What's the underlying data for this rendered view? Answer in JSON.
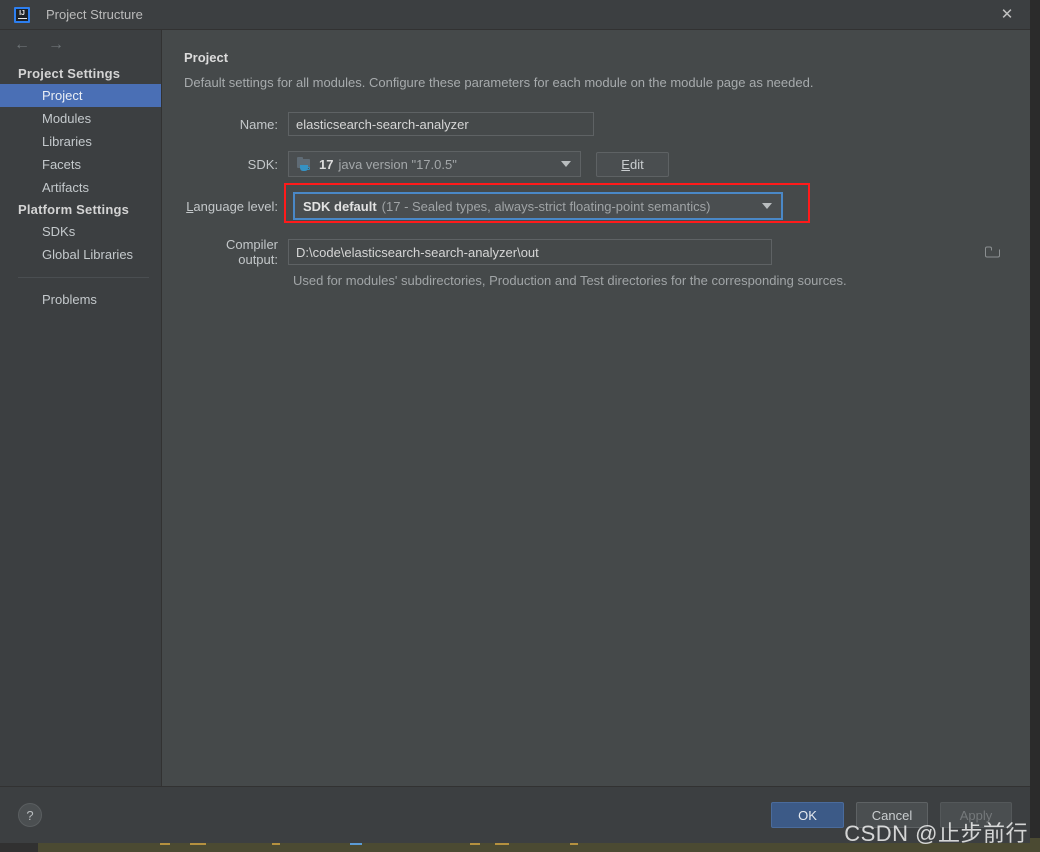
{
  "window": {
    "title": "Project Structure",
    "app_icon": "intellij-idea-icon",
    "close_label": "✕"
  },
  "navigation": {
    "back_arrow": "←",
    "forward_arrow": "→",
    "groups": [
      {
        "header": "Project Settings",
        "items": [
          {
            "label": "Project",
            "selected": true
          },
          {
            "label": "Modules",
            "selected": false
          },
          {
            "label": "Libraries",
            "selected": false
          },
          {
            "label": "Facets",
            "selected": false
          },
          {
            "label": "Artifacts",
            "selected": false
          }
        ]
      },
      {
        "header": "Platform Settings",
        "items": [
          {
            "label": "SDKs",
            "selected": false
          },
          {
            "label": "Global Libraries",
            "selected": false
          }
        ]
      }
    ],
    "extra_items": [
      {
        "label": "Problems",
        "selected": false
      }
    ]
  },
  "content": {
    "title": "Project",
    "subtitle": "Default settings for all modules. Configure these parameters for each module on the module page as needed.",
    "name": {
      "label": "Name:",
      "value": "elasticsearch-search-analyzer",
      "placeholder": ""
    },
    "sdk": {
      "label": "SDK:",
      "version": "17",
      "description": "java version \"17.0.5\"",
      "icon": "java-sdk-icon",
      "edit_button": "Edit",
      "edit_mnemonic": "E",
      "edit_rest": "dit"
    },
    "language_level": {
      "label_mnemonic": "L",
      "label_rest": "anguage level:",
      "primary": "SDK default",
      "secondary": "(17 - Sealed types, always-strict floating-point semantics)",
      "highlighted": true,
      "highlight_color": "#ff1a1a",
      "focus_color": "#4a88c7"
    },
    "compiler_output": {
      "label": "Compiler output:",
      "value": "D:\\code\\elasticsearch-search-analyzer\\out",
      "browse_icon": "folder-icon",
      "hint": "Used for modules' subdirectories, Production and Test directories for the corresponding sources."
    }
  },
  "footer": {
    "help_label": "?",
    "ok_label": "OK",
    "cancel_label": "Cancel",
    "apply_label": "Apply"
  },
  "watermark": {
    "text": "CSDN @止步前行"
  },
  "colors": {
    "dialog_background": "#3c3f41",
    "content_background": "#45494a",
    "selection_blue": "#4a6fb5",
    "ok_button_blue": "#3c5a87",
    "annotation_red": "#ff1a1a",
    "focus_blue": "#4a88c7",
    "desktop_editor": "#4b4a32"
  }
}
